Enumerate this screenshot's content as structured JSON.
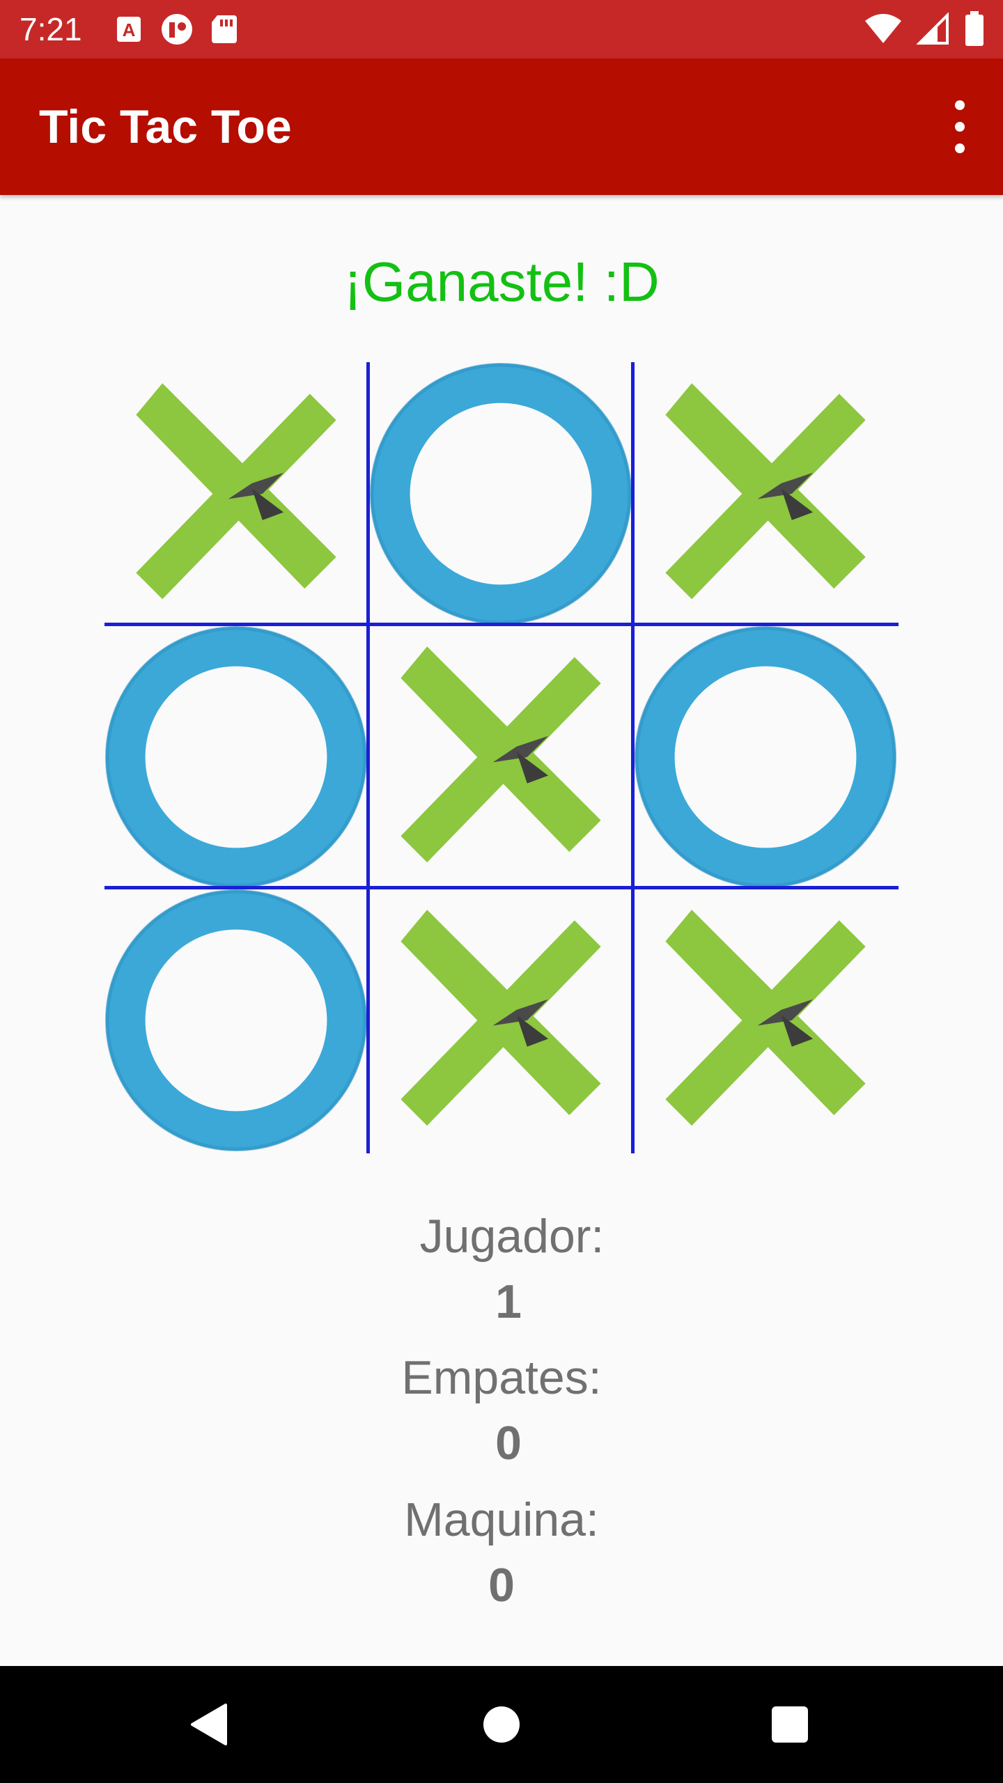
{
  "status_bar": {
    "time": "7:21",
    "left_icons": [
      "text-a-icon",
      "cast-icon",
      "sd-card-icon"
    ],
    "right_icons": [
      "wifi-icon",
      "signal-icon",
      "battery-icon"
    ]
  },
  "app_bar": {
    "title": "Tic Tac Toe",
    "menu_icon": "more-vert-icon"
  },
  "game": {
    "result": "¡Ganaste! :D",
    "result_color": "#13c013",
    "board": [
      "X",
      "O",
      "X",
      "O",
      "X",
      "O",
      "O",
      "X",
      "X"
    ],
    "x_color": "#8dc63f",
    "o_color": "#3ba8d8",
    "grid_color": "#1a1fd6"
  },
  "scores": {
    "player_label": "Jugador:",
    "player_value": "1",
    "ties_label": "Empates:",
    "ties_value": "0",
    "machine_label": "Maquina:",
    "machine_value": "0"
  },
  "nav_bar": {
    "back_icon": "back-triangle-icon",
    "home_icon": "home-circle-icon",
    "recents_icon": "recents-square-icon"
  }
}
